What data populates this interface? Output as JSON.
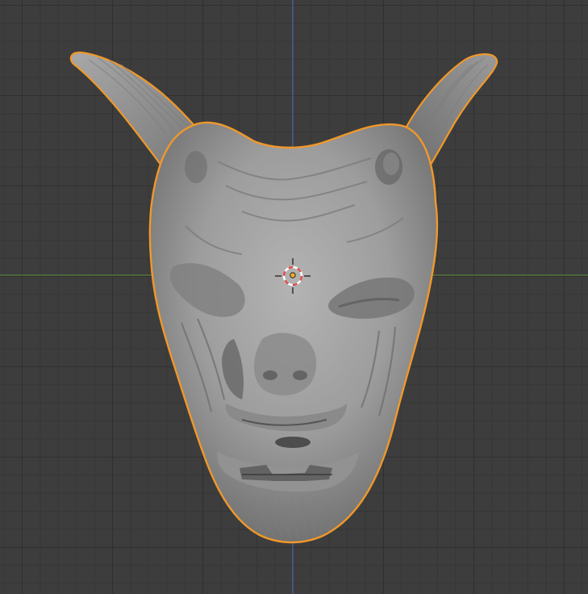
{
  "viewport": {
    "background_color": "#3d3d3d",
    "grid_minor_color": "#363636",
    "grid_major_color": "#303030",
    "x_axis_color": "#5a7d3b",
    "z_axis_color": "#4a6fa8"
  },
  "object": {
    "selected": true,
    "outline_color": "#f0982a",
    "base_color": "#9c9c9c"
  },
  "cursor_3d": {
    "ring_primary_color": "#e04a4a",
    "ring_secondary_color": "#ffffff",
    "origin_color": "#f5a623"
  }
}
